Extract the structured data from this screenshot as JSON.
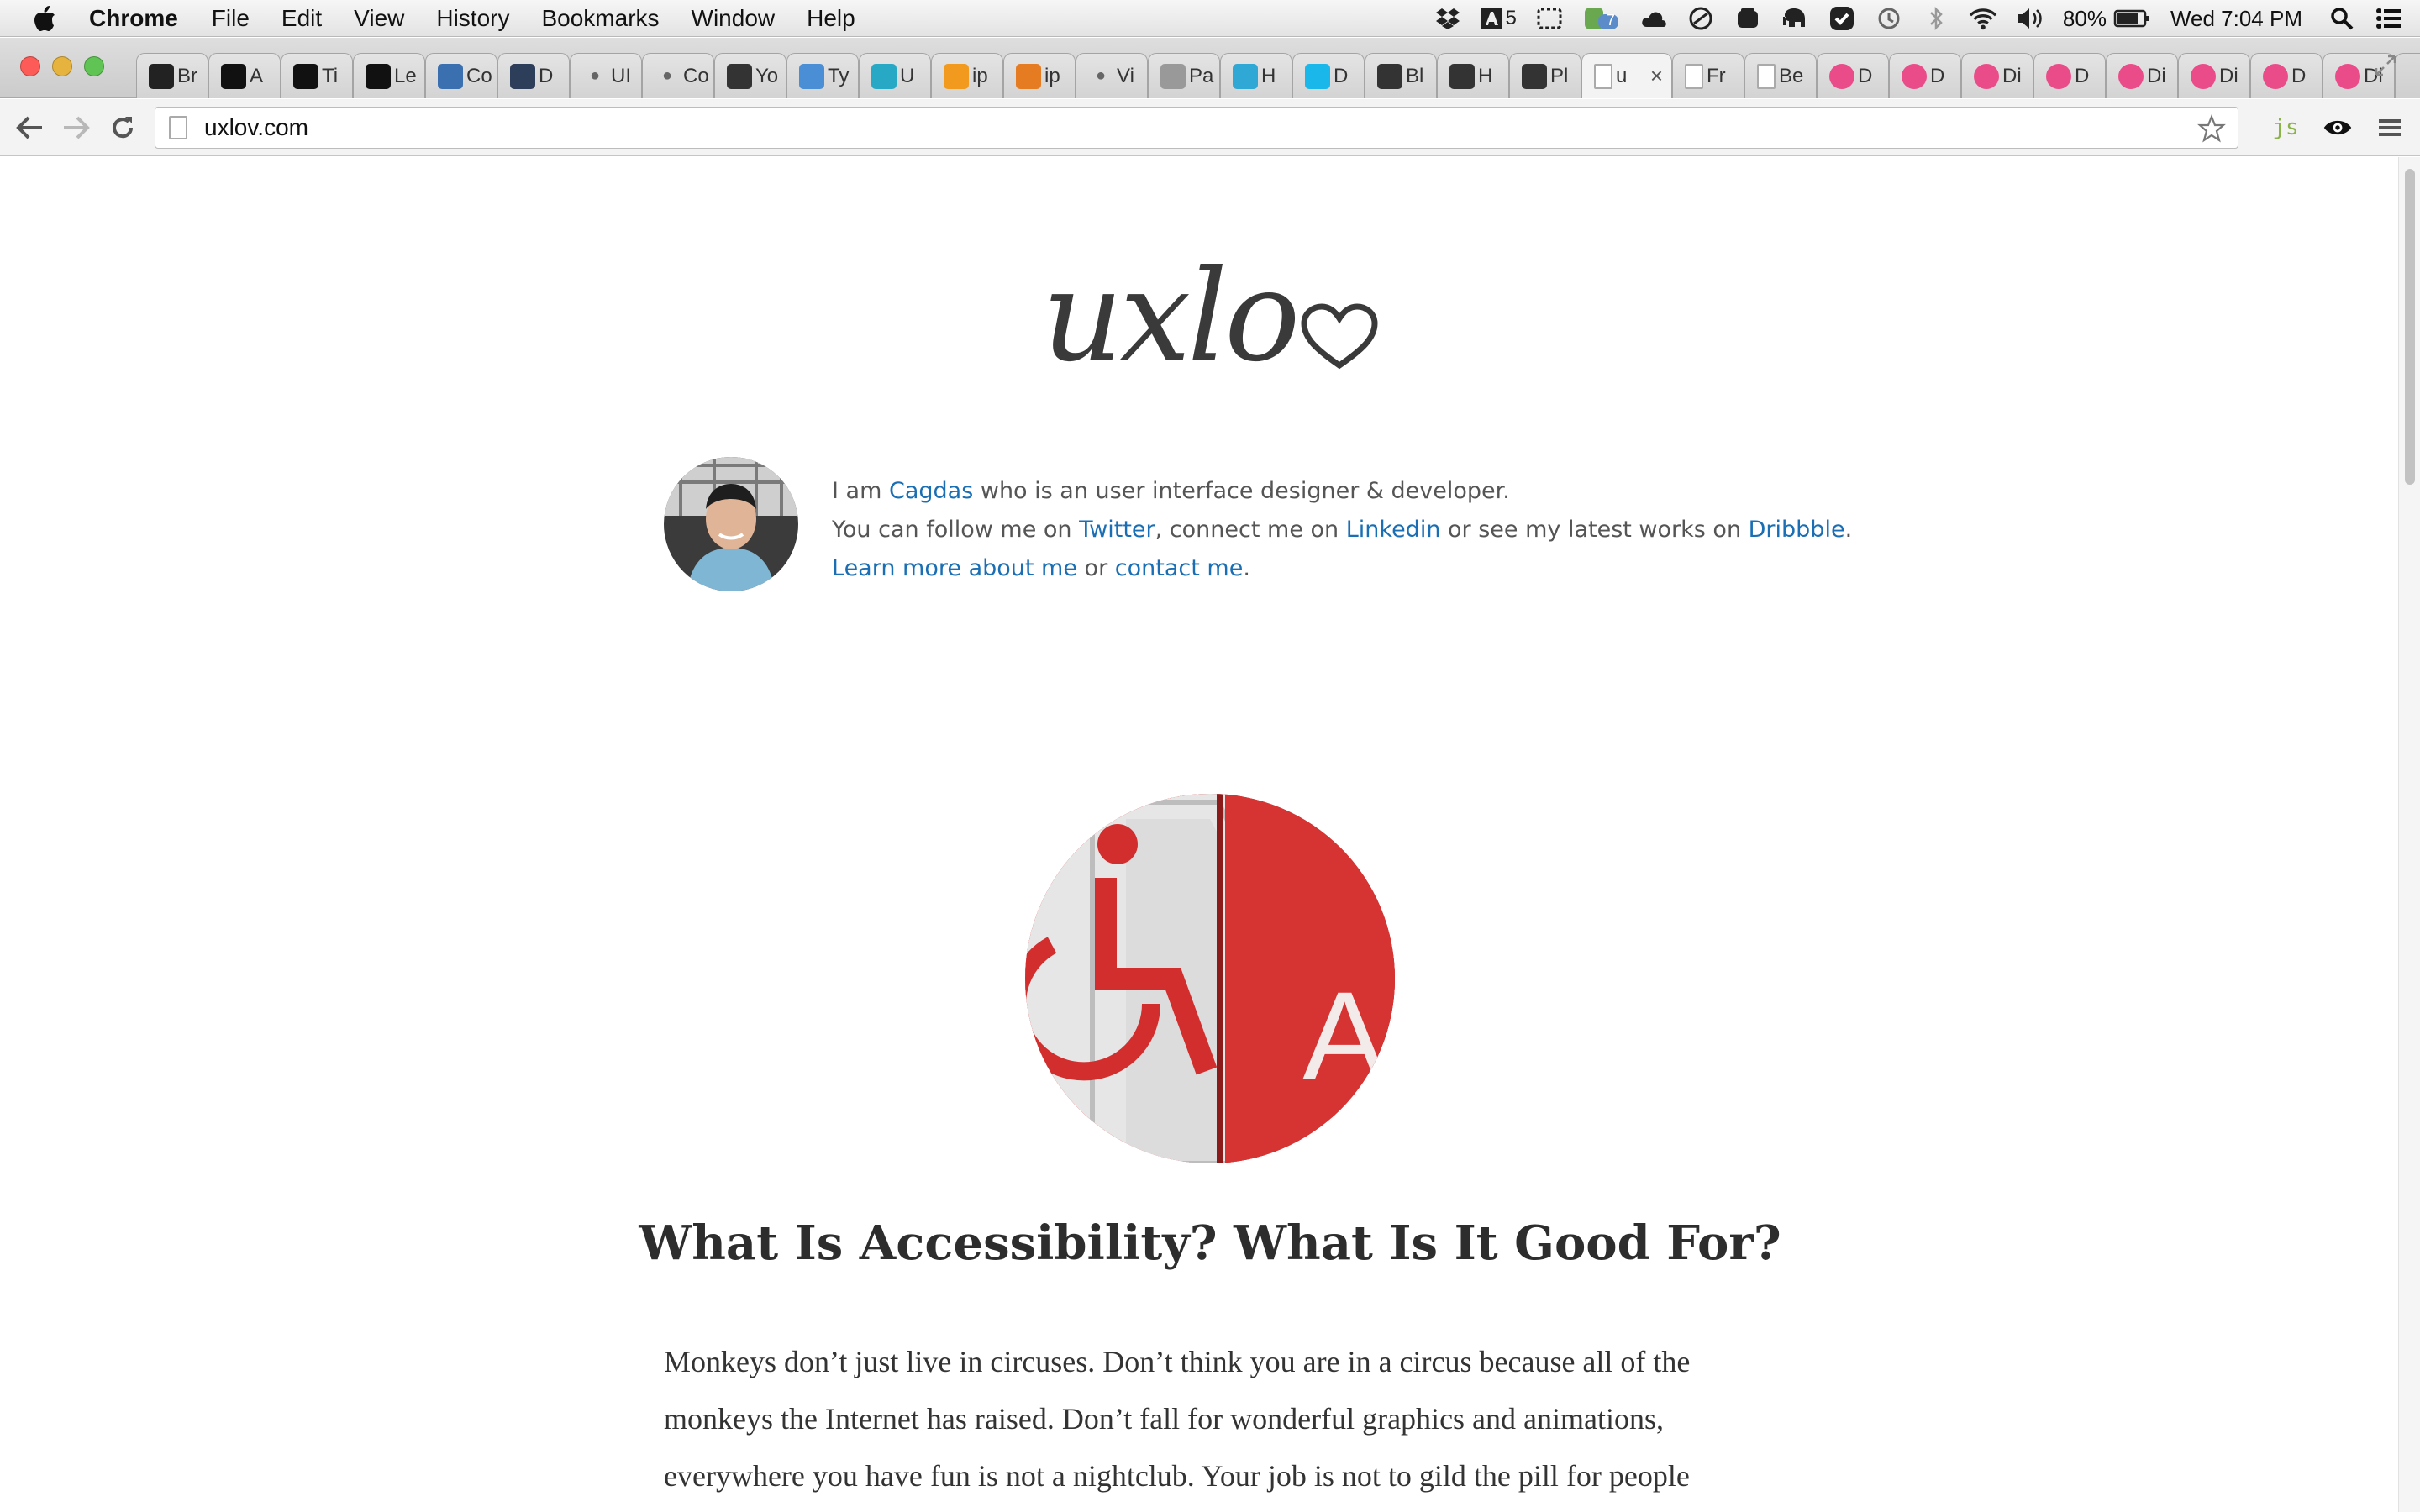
{
  "menubar": {
    "app_name": "Chrome",
    "menus": [
      "File",
      "Edit",
      "View",
      "History",
      "Bookmarks",
      "Window",
      "Help"
    ],
    "status": {
      "adobe_count": "5",
      "evernote_badge": "7",
      "battery": "80%",
      "clock": "Wed 7:04 PM"
    }
  },
  "tabs": [
    {
      "label": "Br",
      "icon": "github-icon",
      "color": "#222222"
    },
    {
      "label": "A",
      "icon": "medium-icon",
      "color": "#111111"
    },
    {
      "label": "Ti",
      "icon": "tumblr-icon",
      "color": "#111111"
    },
    {
      "label": "Le",
      "icon": "font-icon",
      "color": "#111111"
    },
    {
      "label": "Co",
      "icon": "codepen-icon",
      "color": "#3a6fb0"
    },
    {
      "label": "D",
      "icon": "monitor-icon",
      "color": "#2c3e5a"
    },
    {
      "label": "UI",
      "icon": "apple-icon",
      "color": "#666666"
    },
    {
      "label": "Co",
      "icon": "apple-icon",
      "color": "#666666"
    },
    {
      "label": "Yo",
      "icon": "a-icon",
      "color": "#333333"
    },
    {
      "label": "Ty",
      "icon": "typekit-icon",
      "color": "#4a8fd6"
    },
    {
      "label": "U",
      "icon": "square-icon",
      "color": "#27a9c6"
    },
    {
      "label": "ip",
      "icon": "blogger-icon",
      "color": "#f29a1d"
    },
    {
      "label": "ip",
      "icon": "stackoverflow-icon",
      "color": "#e57c22"
    },
    {
      "label": "Vi",
      "icon": "apple-icon",
      "color": "#666666"
    },
    {
      "label": "Pa",
      "icon": "dl-icon",
      "color": "#999999"
    },
    {
      "label": "H",
      "icon": "quote-icon",
      "color": "#2fa8d6"
    },
    {
      "label": "D",
      "icon": "vimeo-icon",
      "color": "#1ab7ea"
    },
    {
      "label": "Bl",
      "icon": "tools-icon",
      "color": "#333333"
    },
    {
      "label": "H",
      "icon": "bc-icon",
      "color": "#333333"
    },
    {
      "label": "Pl",
      "icon": "plus-icon",
      "color": "#333333"
    },
    {
      "label": "u",
      "icon": "page-icon",
      "color": "#ffffff",
      "active": true
    },
    {
      "label": "Fr",
      "icon": "page-icon",
      "color": "#ffffff"
    },
    {
      "label": "Be",
      "icon": "page-icon",
      "color": "#ffffff"
    },
    {
      "label": "D",
      "icon": "dribbble-icon",
      "color": "#ea4c89"
    },
    {
      "label": "D",
      "icon": "dribbble-icon",
      "color": "#ea4c89"
    },
    {
      "label": "Di",
      "icon": "dribbble-icon",
      "color": "#ea4c89"
    },
    {
      "label": "D",
      "icon": "dribbble-icon",
      "color": "#ea4c89"
    },
    {
      "label": "Di",
      "icon": "dribbble-icon",
      "color": "#ea4c89"
    },
    {
      "label": "Di",
      "icon": "dribbble-icon",
      "color": "#ea4c89"
    },
    {
      "label": "D",
      "icon": "dribbble-icon",
      "color": "#ea4c89"
    },
    {
      "label": "Di",
      "icon": "dribbble-icon",
      "color": "#ea4c89"
    }
  ],
  "toolbar": {
    "url": "uxlov.com",
    "extension_js": "js"
  },
  "page": {
    "logo_text": "uxlo",
    "bio": {
      "line1_a": "I am ",
      "name_link": "Cagdas",
      "line1_b": " who is an user interface designer & developer.",
      "line2_a": "You can follow me on ",
      "twitter_link": "Twitter",
      "line2_b": ", connect me on ",
      "linkedin_link": "Linkedin",
      "line2_c": " or see my latest works on ",
      "dribbble_link": "Dribbble",
      "line2_d": ".",
      "about_link": "Learn more about me",
      "line3_b": " or ",
      "contact_link": "contact me",
      "line3_c": "."
    },
    "hero_sign_text": "Ac",
    "post_title": "What Is Accessibility? What Is It Good For?",
    "post_body": "Monkeys don’t just live in circuses. Don’t think you are in a circus because all of the monkeys the Internet has raised. Don’t fall for wonderful graphics and animations, everywhere you have fun is not a nightclub. Your job is not to gild the pill for people"
  },
  "colors": {
    "link": "#1a6fb4",
    "dribbble": "#ea4c89",
    "hero_red": "#d12a2a"
  }
}
